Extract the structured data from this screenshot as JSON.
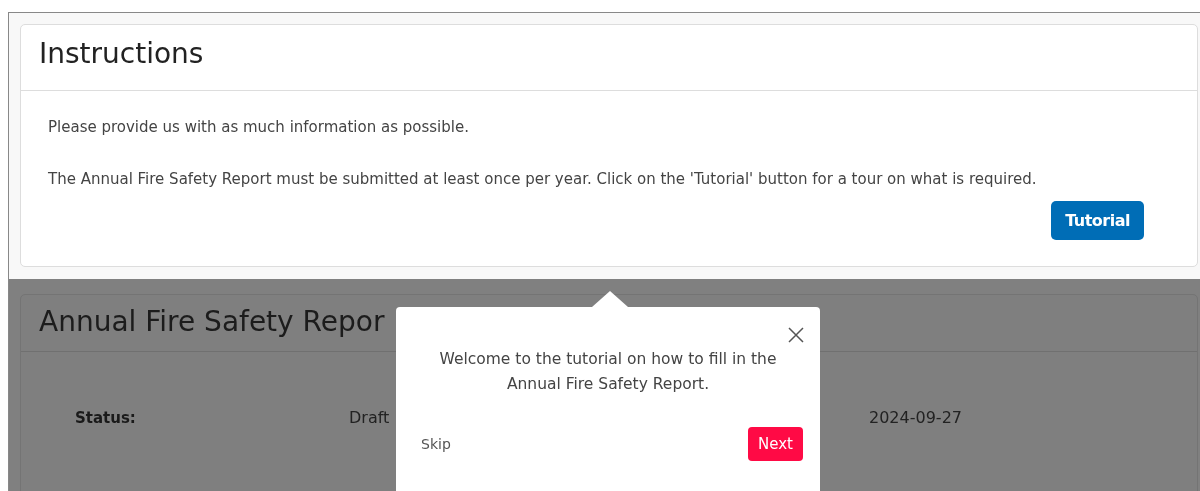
{
  "instructions": {
    "title": "Instructions",
    "paragraphs": [
      "Please provide us with as much information as possible.",
      "The Annual Fire Safety Report must be submitted at least once per year. Click on the 'Tutorial' button for a tour on what is required."
    ],
    "button": "Tutorial"
  },
  "report": {
    "title": "Annual Fire Safety Repor",
    "fields": [
      {
        "label": "Status:",
        "value": "Draft"
      }
    ],
    "column_3": "2024-09-27"
  },
  "tour_popover": {
    "message": "Welcome to the tutorial on how to fill in the Annual Fire Safety Report.",
    "skip": "Skip",
    "next": "Next"
  }
}
